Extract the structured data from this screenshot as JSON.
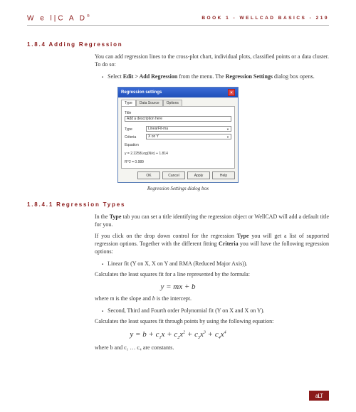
{
  "header": {
    "logo_prefix": "W e l",
    "logo_divider": "|",
    "logo_suffix": "C A D",
    "logo_tm": "®",
    "breadcrumb": "BOOK 1 - WELLCAD BASICS - 219"
  },
  "section1": {
    "number_title": "1.8.4 Adding Regression",
    "p1": "You can add regression lines to the cross-plot chart, individual plots, classified points or a data cluster. To do so:",
    "b1_pre": "Select ",
    "b1_bold": "Edit > Add Regression",
    "b1_mid": " from the menu. The ",
    "b1_bold2": "Regression Settings",
    "b1_post": " dialog box opens."
  },
  "dialog": {
    "title": "Regression settings",
    "tabs": {
      "t1": "Type",
      "t2": "Data Source",
      "t3": "Options"
    },
    "labels": {
      "title_lbl": "Title",
      "type_lbl": "Type",
      "criteria_lbl": "Criteria",
      "eq_lbl": "Equation"
    },
    "values": {
      "title_val": "Add a description here",
      "type_val": "LinearFit-ma",
      "criteria_val": "X on Y"
    },
    "eq1": "y = 2.2258Log(N/x) + 1.814",
    "eq2": "R^2 = 0.989",
    "buttons": {
      "ok": "OK",
      "cancel": "Cancel",
      "apply": "Apply",
      "help": "Help"
    },
    "caption": "Regression Settings dialog box"
  },
  "section2": {
    "number_title": "1.8.4.1 Regression Types",
    "p1_pre": "In the ",
    "p1_b1": "Type",
    "p1_post": " tab you can set a title identifying the regression object or WellCAD will add a default title for you.",
    "p2_pre": "If you click on the drop down control for the regression ",
    "p2_b1": "Type",
    "p2_mid": " you will get a list of supported regression options. Together with the different fitting ",
    "p2_b2": "Criteria",
    "p2_post": " you will have the following regression options:",
    "b1": "Linear fit (Y on X, X on Y and RMA (Reduced Major Axis)).",
    "p3": "Calculates the least squares fit for a line represented by the formula:",
    "formula1": "y = mx + b",
    "p4_pre": "where ",
    "p4_i1": "m",
    "p4_mid": " is the slope and ",
    "p4_i2": "b",
    "p4_post": " is the intercept.",
    "b2": "Second, Third and Fourth order Polynomial fit (Y on X and X on Y).",
    "p5": "Calculates the least squares fit through points by using the following equation:",
    "formula2_html": "y = b + c<sub>1</sub>x + c<sub>2</sub>x<sup>2</sup> + c<sub>3</sub>x<sup>3</sup> + c<sub>4</sub>x<sup>4</sup>",
    "p6": "where b and c₁ … c₄ are constants."
  },
  "footer": {
    "logo": "aLT"
  }
}
